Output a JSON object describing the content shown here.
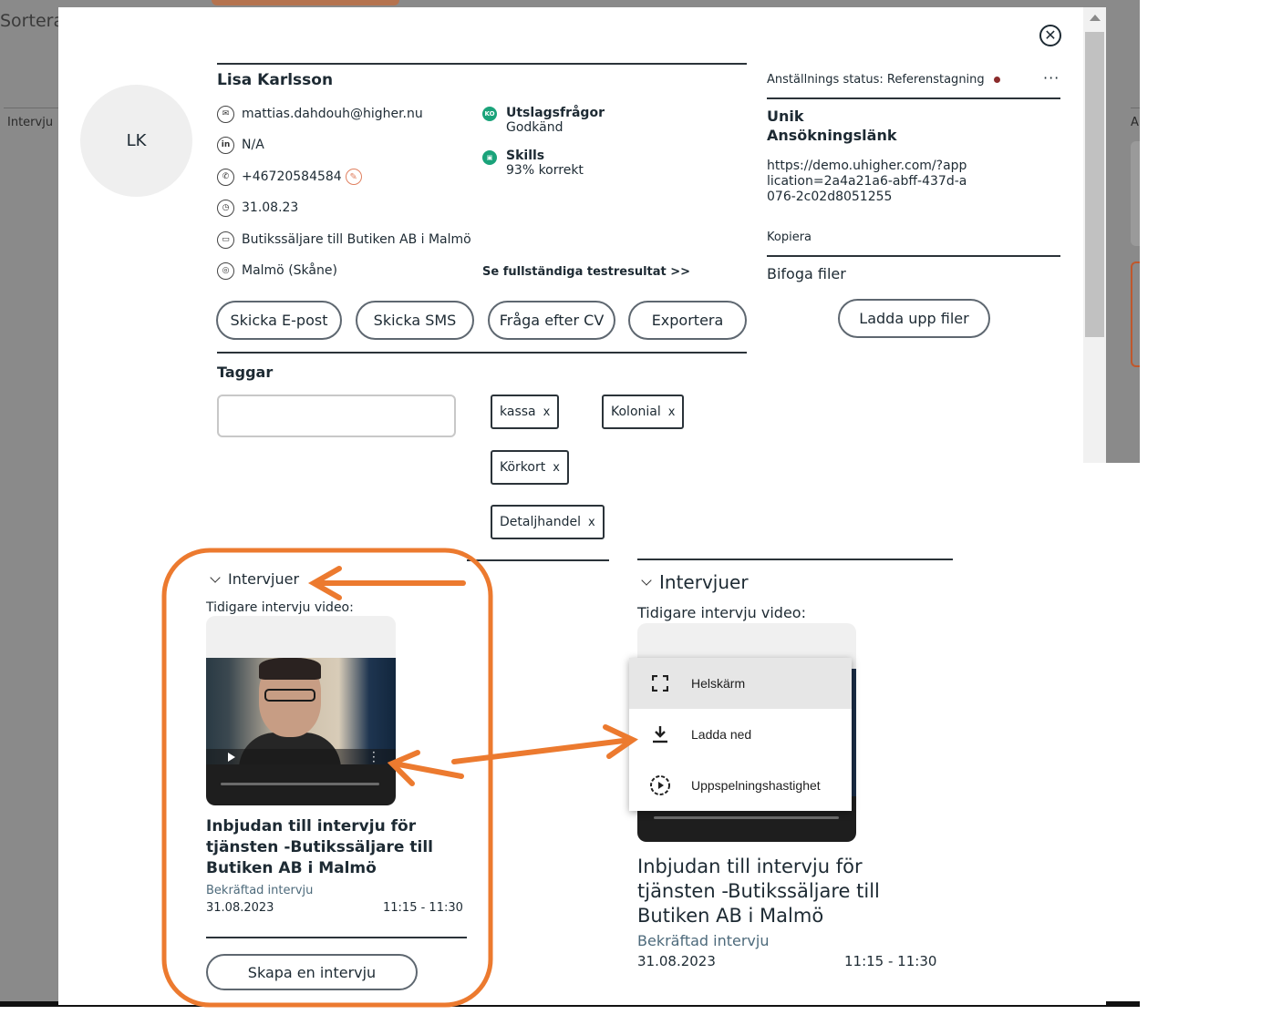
{
  "background": {
    "sort_label": "Sortera",
    "left_col_label": "Intervju",
    "right_col_label": "A"
  },
  "candidate": {
    "initials": "LK",
    "name": "Lisa Karlsson",
    "email": "mattias.dahdouh@higher.nu",
    "linkedin": "N/A",
    "phone": "+46720584584",
    "date": "31.08.23",
    "job": "Butikssäljare till Butiken AB i Malmö",
    "location": "Malmö (Skåne)"
  },
  "qualifications": [
    {
      "title": "Utslagsfrågor",
      "sub": "Godkänd",
      "icon": "KO"
    },
    {
      "title": "Skills",
      "sub": "93% korrekt",
      "icon": "skills-icon"
    }
  ],
  "test_results_link": "Se fullständiga testresultat >>",
  "actions": {
    "email": "Skicka E-post",
    "sms": "Skicka SMS",
    "cv": "Fråga efter CV",
    "export": "Exportera"
  },
  "tags_section": {
    "title": "Taggar",
    "input_value": "",
    "tags": [
      "kassa",
      "Kolonial",
      "Körkort",
      "Detaljhandel"
    ],
    "remove_glyph": "x"
  },
  "status": {
    "label": "Anställnings status:",
    "value": "Referenstagning",
    "dot_color": "#8b2b2b",
    "menu_glyph": "···"
  },
  "application_link": {
    "title_line1": "Unik",
    "title_line2": "Ansökningslänk",
    "url": "https://demo.uhigher.com/?application=2a4a21a6-abff-437d-a076-2c02d8051255",
    "copy": "Kopiera"
  },
  "attachments": {
    "title": "Bifoga filer",
    "upload": "Ladda upp filer"
  },
  "interviews_left": {
    "header": "Intervjuer",
    "sub": "Tidigare intervju video:",
    "title": "Inbjudan till intervju för tjänsten -Butikssäljare till Butiken AB i Malmö",
    "status": "Bekräftad intervju",
    "date": "31.08.2023",
    "time": "11:15 - 11:30",
    "create": "Skapa en intervju"
  },
  "interviews_right": {
    "header": "Intervjuer",
    "sub": "Tidigare intervju video:",
    "title": "Inbjudan till intervju för tjänsten -Butikssäljare till Butiken AB i Malmö",
    "status": "Bekräftad intervju",
    "date": "31.08.2023",
    "time": "11:15 - 11:30"
  },
  "video_menu": {
    "items": [
      {
        "label": "Helskärm",
        "icon": "fullscreen-icon"
      },
      {
        "label": "Ladda ned",
        "icon": "download-icon"
      },
      {
        "label": "Uppspelningshastighet",
        "icon": "playback-speed-icon"
      }
    ]
  },
  "colors": {
    "annotation": "#ec7a2f",
    "success": "#1aa37a",
    "muted_text": "#4d6a7b"
  }
}
